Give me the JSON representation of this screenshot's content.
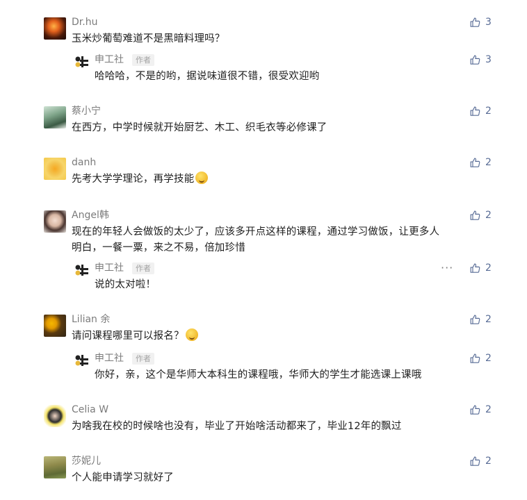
{
  "colors": {
    "name": "#7b7b7b",
    "like": "#576b95",
    "text": "#1e1e1e",
    "badge_bg": "#f1f1f1",
    "badge_text": "#a3a3a3"
  },
  "comments": [
    {
      "name": "Dr.hu",
      "text": "玉米炒葡萄难道不是黑暗料理吗？",
      "likes": "3",
      "avatar": "sunset-avatar",
      "reply": {
        "name": "申工社",
        "badge": "作者",
        "text": "哈哈哈，不是的哟，据说味道很不错，很受欢迎哟",
        "likes": "3"
      }
    },
    {
      "name": "蔡小宁",
      "text": "在西方，中学时候就开始厨艺、木工、织毛衣等必修课了",
      "likes": "2",
      "avatar": "landscape-avatar"
    },
    {
      "name": "danh",
      "text": "先考大学学理论，再学技能",
      "likes": "2",
      "avatar": "flower-avatar"
    },
    {
      "name": "Angel韩",
      "text_line1": "现在的年轻人会做饭的太少了，应该多开点这样的课程，通过学习做饭，让更多人",
      "text_line2": "明白，一餐一粟，来之不易，倍加珍惜",
      "likes": "2",
      "avatar": "portrait-avatar",
      "reply": {
        "name": "申工社",
        "badge": "作者",
        "text": "说的太对啦！",
        "likes": "2",
        "more": "···"
      }
    },
    {
      "name": "Lilian 余",
      "text": "请问课程哪里可以报名？",
      "likes": "2",
      "avatar": "sunflower-avatar",
      "reply": {
        "name": "申工社",
        "badge": "作者",
        "text": "你好，亲，这个是华师大本科生的课程哦，华师大的学生才能选课上课哦",
        "likes": "2"
      }
    },
    {
      "name": "Celia W",
      "text": "为啥我在校的时候啥也没有，毕业了开始啥活动都来了，毕业12年的飘过",
      "likes": "2",
      "avatar": "sunglasses-avatar"
    },
    {
      "name": "莎妮儿",
      "text": "个人能申请学习就好了",
      "likes": "2",
      "avatar": "field-avatar"
    }
  ]
}
